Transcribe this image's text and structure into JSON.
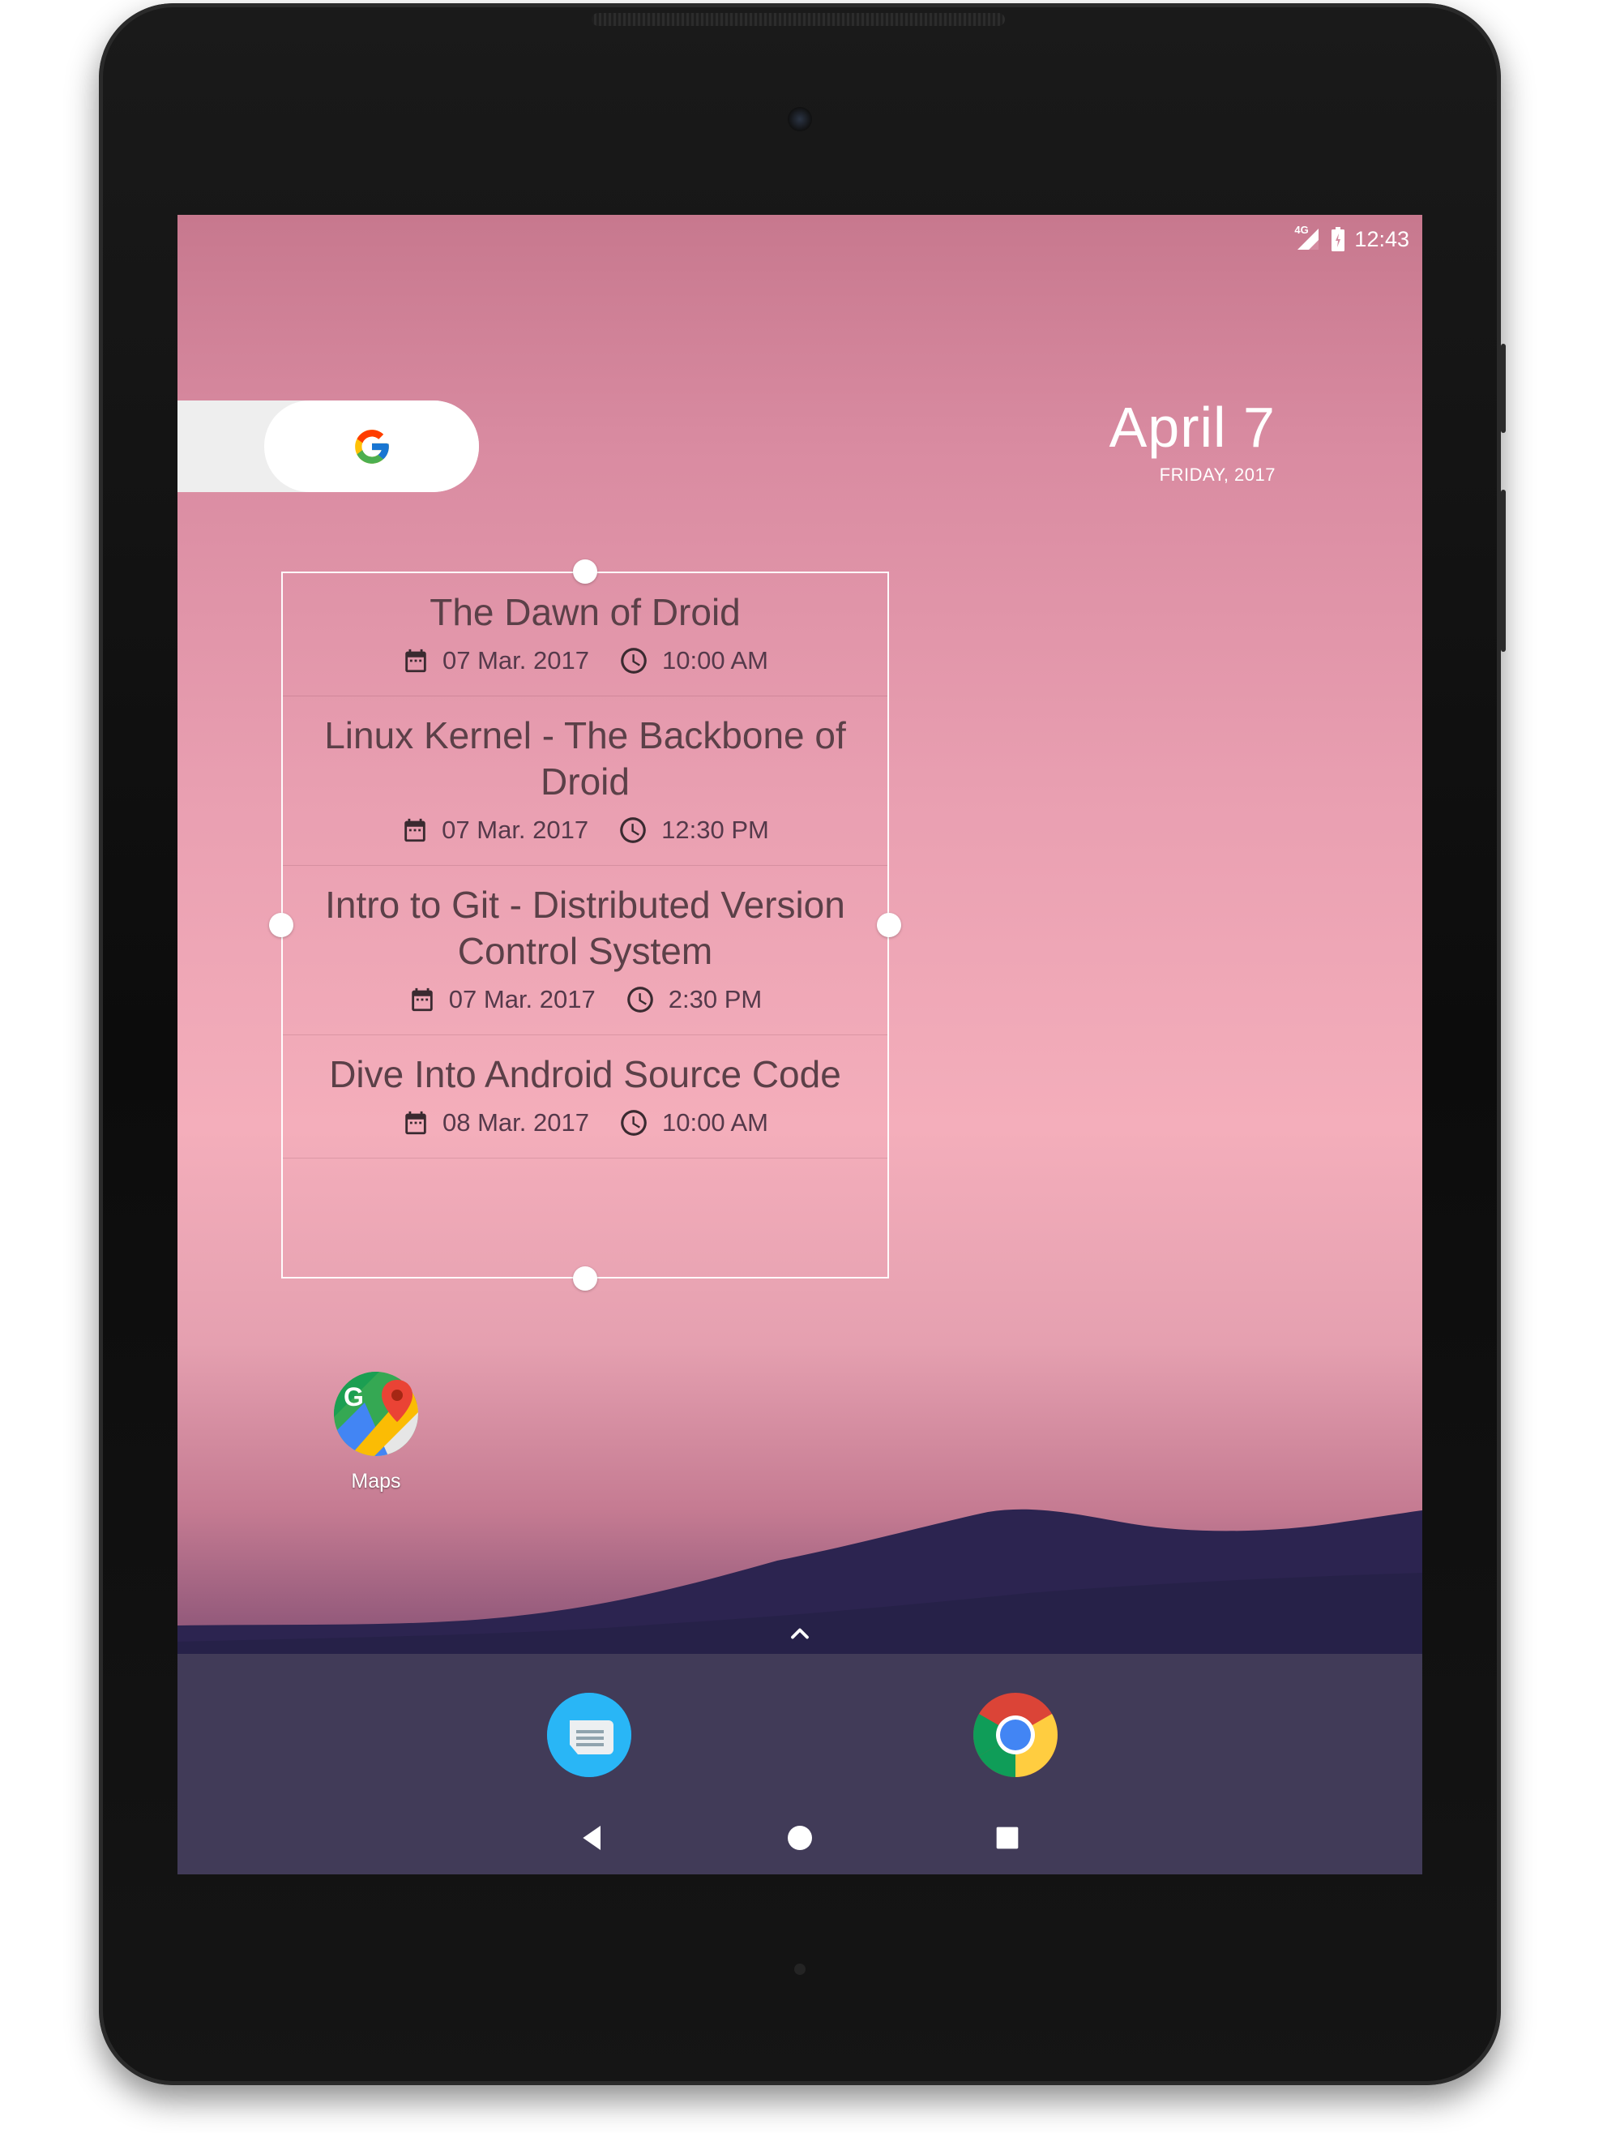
{
  "status_bar": {
    "network": "4G",
    "time": "12:43"
  },
  "search": {
    "icon": "google-icon"
  },
  "date_widget": {
    "date": "April 7",
    "weekday_year": "FRIDAY, 2017"
  },
  "schedule_widget": {
    "sessions": [
      {
        "title": "The Dawn of Droid",
        "date": "07 Mar. 2017",
        "time": "10:00 AM"
      },
      {
        "title": "Linux Kernel - The Backbone of Droid",
        "date": "07 Mar. 2017",
        "time": "12:30 PM"
      },
      {
        "title": "Intro to Git - Distributed Version Control System",
        "date": "07 Mar. 2017",
        "time": "2:30 PM"
      },
      {
        "title": "Dive Into Android Source Code",
        "date": "08 Mar. 2017",
        "time": "10:00 AM"
      }
    ]
  },
  "home_apps": [
    {
      "label": "Maps",
      "icon": "maps-icon"
    }
  ],
  "dock": {
    "apps": [
      {
        "name": "Messages",
        "icon": "messages-icon"
      },
      {
        "name": "Chrome",
        "icon": "chrome-icon"
      }
    ]
  },
  "navigation": {
    "buttons": [
      "back-icon",
      "home-icon",
      "recents-icon"
    ]
  }
}
